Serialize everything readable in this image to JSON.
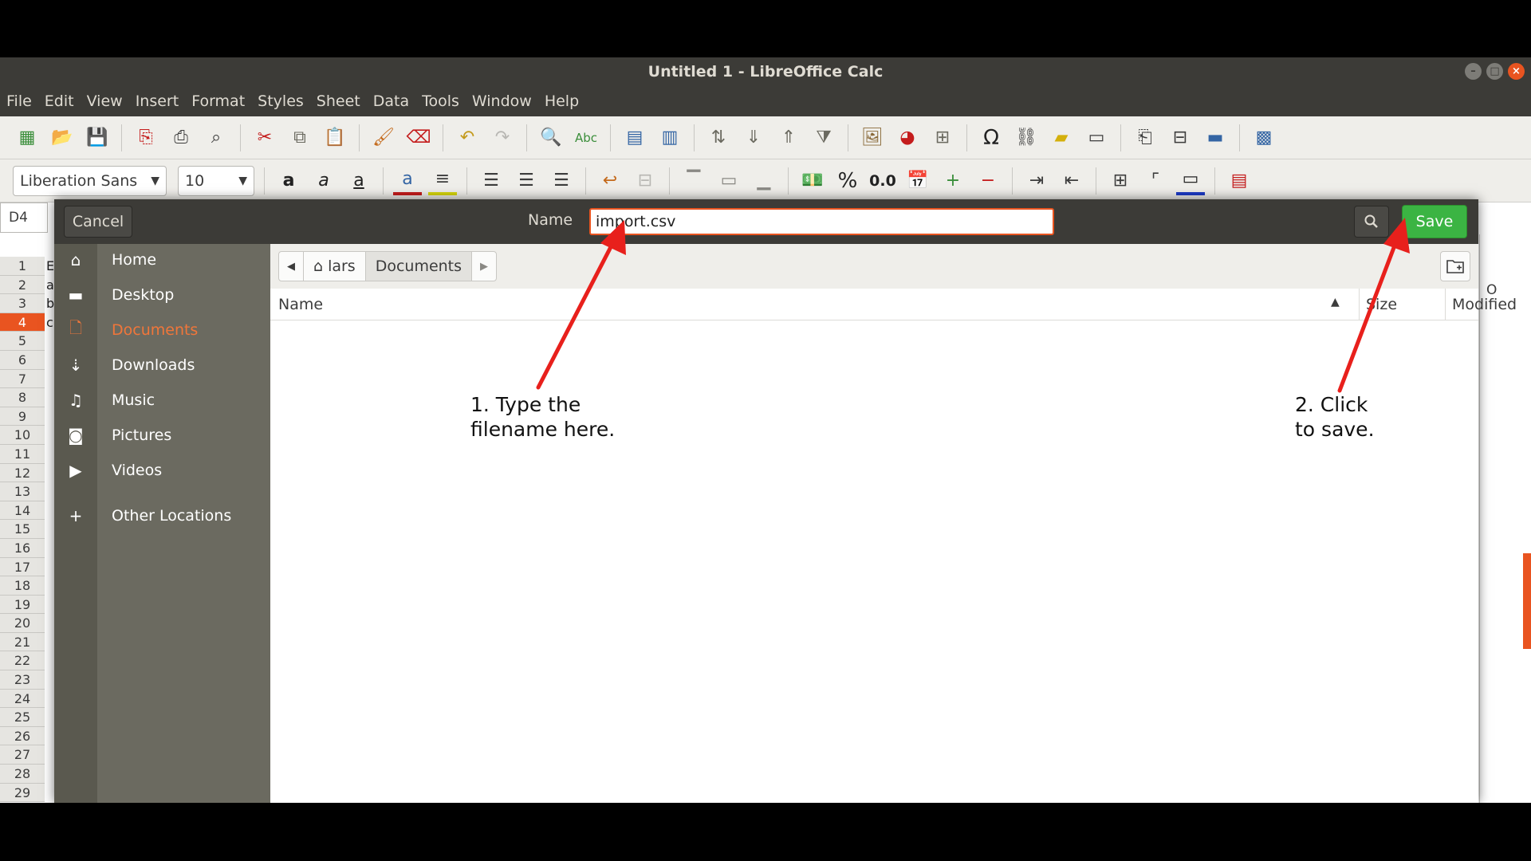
{
  "window": {
    "title": "Untitled 1 - LibreOffice Calc"
  },
  "menubar": {
    "items": [
      "File",
      "Edit",
      "View",
      "Insert",
      "Format",
      "Styles",
      "Sheet",
      "Data",
      "Tools",
      "Window",
      "Help"
    ]
  },
  "format_bar": {
    "font_name": "Liberation Sans",
    "font_size": "10",
    "number_format_percent": "%",
    "number_format_decimal": "0.0"
  },
  "sheet": {
    "name_box": "D4",
    "row_numbers": [
      "1",
      "2",
      "3",
      "4",
      "5",
      "6",
      "7",
      "8",
      "9",
      "10",
      "11",
      "12",
      "13",
      "14",
      "15",
      "16",
      "17",
      "18",
      "19",
      "20",
      "21",
      "22",
      "23",
      "24",
      "25",
      "26",
      "27",
      "28",
      "29"
    ],
    "active_row": "4",
    "col_o_label": "O",
    "cells_a": [
      "E",
      "a",
      "b",
      "c"
    ]
  },
  "dialog": {
    "cancel_label": "Cancel",
    "name_label": "Name",
    "filename_value": "import.csv",
    "save_label": "Save",
    "sidebar": [
      {
        "label": "Home",
        "icon": "home-icon"
      },
      {
        "label": "Desktop",
        "icon": "folder-icon"
      },
      {
        "label": "Documents",
        "icon": "document-icon",
        "active": true
      },
      {
        "label": "Downloads",
        "icon": "download-icon"
      },
      {
        "label": "Music",
        "icon": "music-icon"
      },
      {
        "label": "Pictures",
        "icon": "camera-icon"
      },
      {
        "label": "Videos",
        "icon": "video-icon"
      },
      {
        "label": "Other Locations",
        "icon": "plus-icon"
      }
    ],
    "path": {
      "home_label": "lars",
      "current_label": "Documents"
    },
    "columns": {
      "name": "Name",
      "size": "Size",
      "modified": "Modified"
    }
  },
  "annotations": {
    "step1": "1. Type the\nfilename here.",
    "step2": "2. Click\nto save."
  },
  "colors": {
    "accent_orange": "#e95420",
    "save_green": "#3bb443",
    "arrow_red": "#e8201c"
  }
}
